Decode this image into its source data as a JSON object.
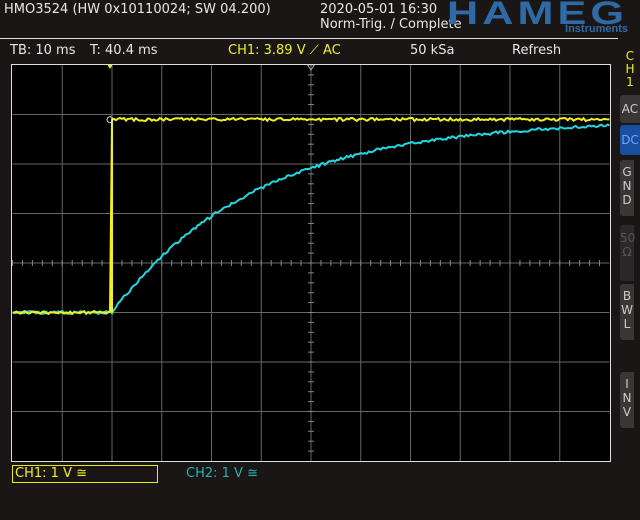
{
  "header": {
    "device": "HMO3524 (HW 0x10110024; SW 04.200)",
    "datetime": "2020-05-01 16:30",
    "trigger_state": "Norm-Trig. / Complete",
    "logo": "HAMEG",
    "logo_sub": "Instruments"
  },
  "status": {
    "timebase": "TB: 10 ms",
    "trigger_time": "T: 40.4 ms",
    "ch1_trigger": "CH1: 3.89 V ⟋ AC",
    "sample_rate": "50 kSa",
    "mode": "Refresh"
  },
  "side": {
    "channel": "C H 1",
    "buttons": [
      "AC",
      "DC",
      "G N D",
      "50 Ω",
      "B W L",
      "I N V"
    ],
    "active": "DC",
    "disabled": "50 Ω"
  },
  "footer": {
    "ch1": "CH1: 1 V ≅",
    "ch2": "CH2: 1 V ≅"
  },
  "colors": {
    "ch1": "#f0f020",
    "ch2": "#20d8e0",
    "active_button": "#1a4fa0"
  },
  "traces": {
    "time_per_div_ms": 10,
    "volts_per_div": 1,
    "step_time_div": 2,
    "low_div": -1,
    "ch1_high_div": 2.9,
    "ch2_tau_div": 2.9
  }
}
